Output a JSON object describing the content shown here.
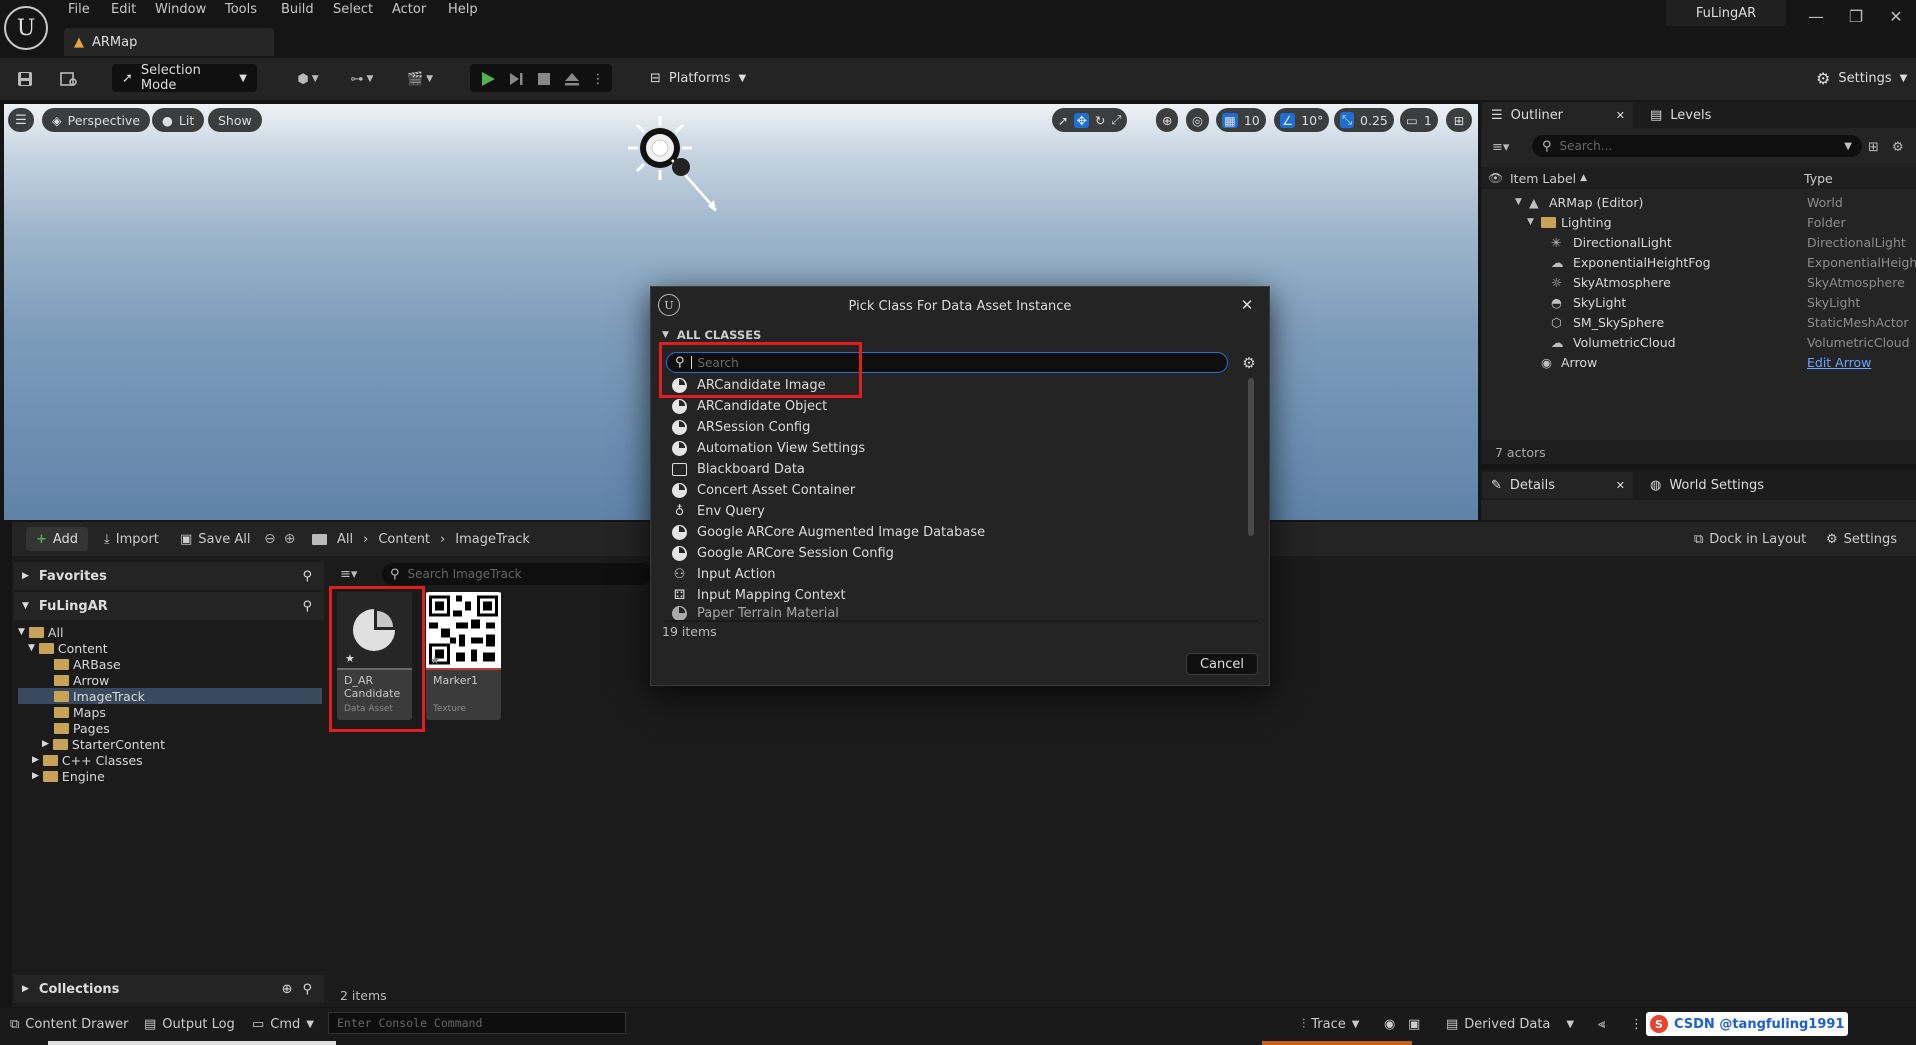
{
  "menu": [
    "File",
    "Edit",
    "Window",
    "Tools",
    "Build",
    "Select",
    "Actor",
    "Help"
  ],
  "project_name": "FuLingAR",
  "doc_tab": "ARMap",
  "toolbar": {
    "selection_mode": "Selection Mode",
    "platforms": "Platforms",
    "settings": "Settings"
  },
  "viewport": {
    "perspective": "Perspective",
    "lit": "Lit",
    "show": "Show",
    "grid_snap": "10",
    "rot_snap": "10°",
    "scale_snap": "0.25",
    "camera_speed": "1"
  },
  "outliner": {
    "tab": "Outliner",
    "levels_tab": "Levels",
    "search_placeholder": "Search...",
    "col_label": "Item Label",
    "col_type": "Type",
    "rows": [
      {
        "label": "ARMap (Editor)",
        "type": "World"
      },
      {
        "label": "Lighting",
        "type": "Folder"
      },
      {
        "label": "DirectionalLight",
        "type": "DirectionalLight"
      },
      {
        "label": "ExponentialHeightFog",
        "type": "ExponentialHeightF"
      },
      {
        "label": "SkyAtmosphere",
        "type": "SkyAtmosphere"
      },
      {
        "label": "SkyLight",
        "type": "SkyLight"
      },
      {
        "label": "SM_SkySphere",
        "type": "StaticMeshActor"
      },
      {
        "label": "VolumetricCloud",
        "type": "VolumetricCloud"
      },
      {
        "label": "Arrow",
        "type": "Edit Arrow"
      }
    ],
    "count": "7 actors"
  },
  "details": {
    "tab": "Details",
    "world_settings_tab": "World Settings"
  },
  "content_drawer": {
    "add": "Add",
    "import": "Import",
    "save_all": "Save All",
    "breadcrumb": [
      "All",
      "Content",
      "ImageTrack"
    ],
    "dock": "Dock in Layout",
    "settings": "Settings",
    "favorites": "Favorites",
    "project": "FuLingAR",
    "tree": [
      "All",
      "Content",
      "ARBase",
      "Arrow",
      "ImageTrack",
      "Maps",
      "Pages",
      "StarterContent",
      "C++ Classes",
      "Engine"
    ],
    "collections": "Collections",
    "search_placeholder": "Search ImageTrack",
    "assets": [
      {
        "name": "D_AR Candidate",
        "type": "Data Asset"
      },
      {
        "name": "Marker1",
        "type": "Texture"
      }
    ],
    "item_count": "2 items"
  },
  "statusbar": {
    "content_drawer": "Content Drawer",
    "output_log": "Output Log",
    "cmd": "Cmd",
    "console_placeholder": "Enter Console Command",
    "trace": "Trace",
    "derived_data": "Derived Data",
    "watermark": "CSDN @tangfuling1991"
  },
  "dialog": {
    "title": "Pick Class For Data Asset Instance",
    "section": "ALL CLASSES",
    "search_placeholder": "Search",
    "classes": [
      "ARCandidate Image",
      "ARCandidate Object",
      "ARSession Config",
      "Automation View Settings",
      "Blackboard Data",
      "Concert Asset Container",
      "Env Query",
      "Google ARCore Augmented Image Database",
      "Google ARCore Session Config",
      "Input Action",
      "Input Mapping Context",
      "Paper Terrain Material"
    ],
    "item_count": "19 items",
    "cancel": "Cancel"
  }
}
